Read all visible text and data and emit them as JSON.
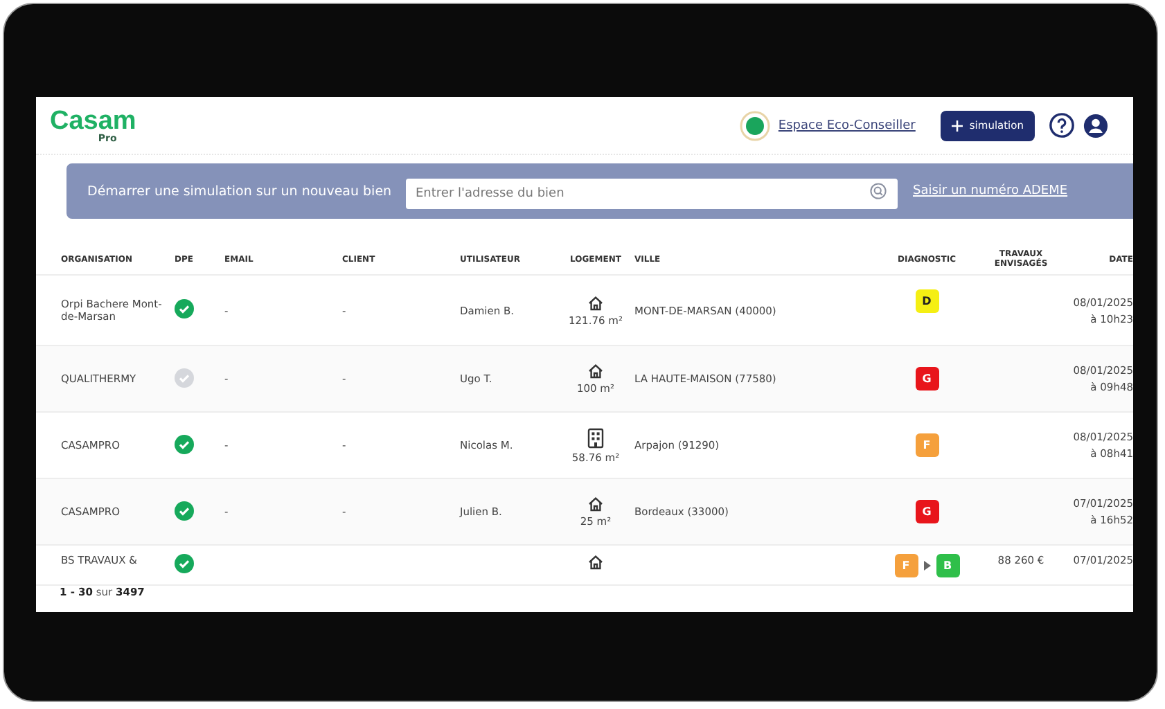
{
  "header": {
    "logo": "Casam",
    "logo_sub": "Pro",
    "eco_link": "Espace Eco-Conseiller",
    "new_button": "simulation"
  },
  "banner": {
    "text": "Démarrer une simulation sur un nouveau bien",
    "placeholder": "Entrer l'adresse du bien",
    "link": "Saisir un numéro ADEME"
  },
  "table": {
    "columns": [
      "ORGANISATION",
      "DPE",
      "EMAIL",
      "CLIENT",
      "UTILISATEUR",
      "LOGEMENT",
      "VILLE",
      "DIAGNOSTIC",
      "TRAVAUX ENVISAGÉS",
      "DATE"
    ],
    "rows": [
      {
        "organisation": "Orpi Bachere Mont-de-Marsan",
        "dpe_checked": true,
        "email": "-",
        "client": "-",
        "utilisateur": "Damien B.",
        "logement": {
          "kind": "house",
          "surface": "121.76 m²"
        },
        "ville": "MONT-DE-MARSAN (40000)",
        "diagnostic": [
          {
            "letter": "D",
            "color": "#f5ef13"
          }
        ],
        "date": "08/01/2025",
        "time": "à 10h23"
      },
      {
        "organisation": "QUALITHERMY",
        "dpe_checked": false,
        "email": "-",
        "client": "-",
        "utilisateur": "Ugo T.",
        "logement": {
          "kind": "house",
          "surface": "100 m²"
        },
        "ville": "LA HAUTE-MAISON (77580)",
        "diagnostic": [
          {
            "letter": "G",
            "color": "#e8151b"
          }
        ],
        "date": "08/01/2025",
        "time": "à 09h48"
      },
      {
        "organisation": "CASAMPRO",
        "dpe_checked": true,
        "email": "-",
        "client": "-",
        "utilisateur": "Nicolas M.",
        "logement": {
          "kind": "building",
          "surface": "58.76 m²"
        },
        "ville": "Arpajon (91290)",
        "diagnostic": [
          {
            "letter": "F",
            "color": "#f5a03c"
          }
        ],
        "date": "08/01/2025",
        "time": "à 08h41"
      },
      {
        "organisation": "CASAMPRO",
        "dpe_checked": true,
        "email": "-",
        "client": "-",
        "utilisateur": "Julien B.",
        "logement": {
          "kind": "house",
          "surface": "25 m²"
        },
        "ville": "Bordeaux (33000)",
        "diagnostic": [
          {
            "letter": "G",
            "color": "#e8151b"
          }
        ],
        "date": "07/01/2025",
        "time": "à 16h52"
      },
      {
        "organisation": "BS TRAVAUX &",
        "dpe_checked": true,
        "logement": {
          "kind": "house"
        },
        "diagnostic": [
          {
            "letter": "F",
            "color": "#f5a03c"
          },
          {
            "letter": "B",
            "color": "#2fbf4a"
          }
        ],
        "travaux": "88 260 €",
        "date": "07/01/2025"
      }
    ]
  },
  "footer": {
    "range": "1 - 30",
    "sep": "sur",
    "total": "3497"
  }
}
